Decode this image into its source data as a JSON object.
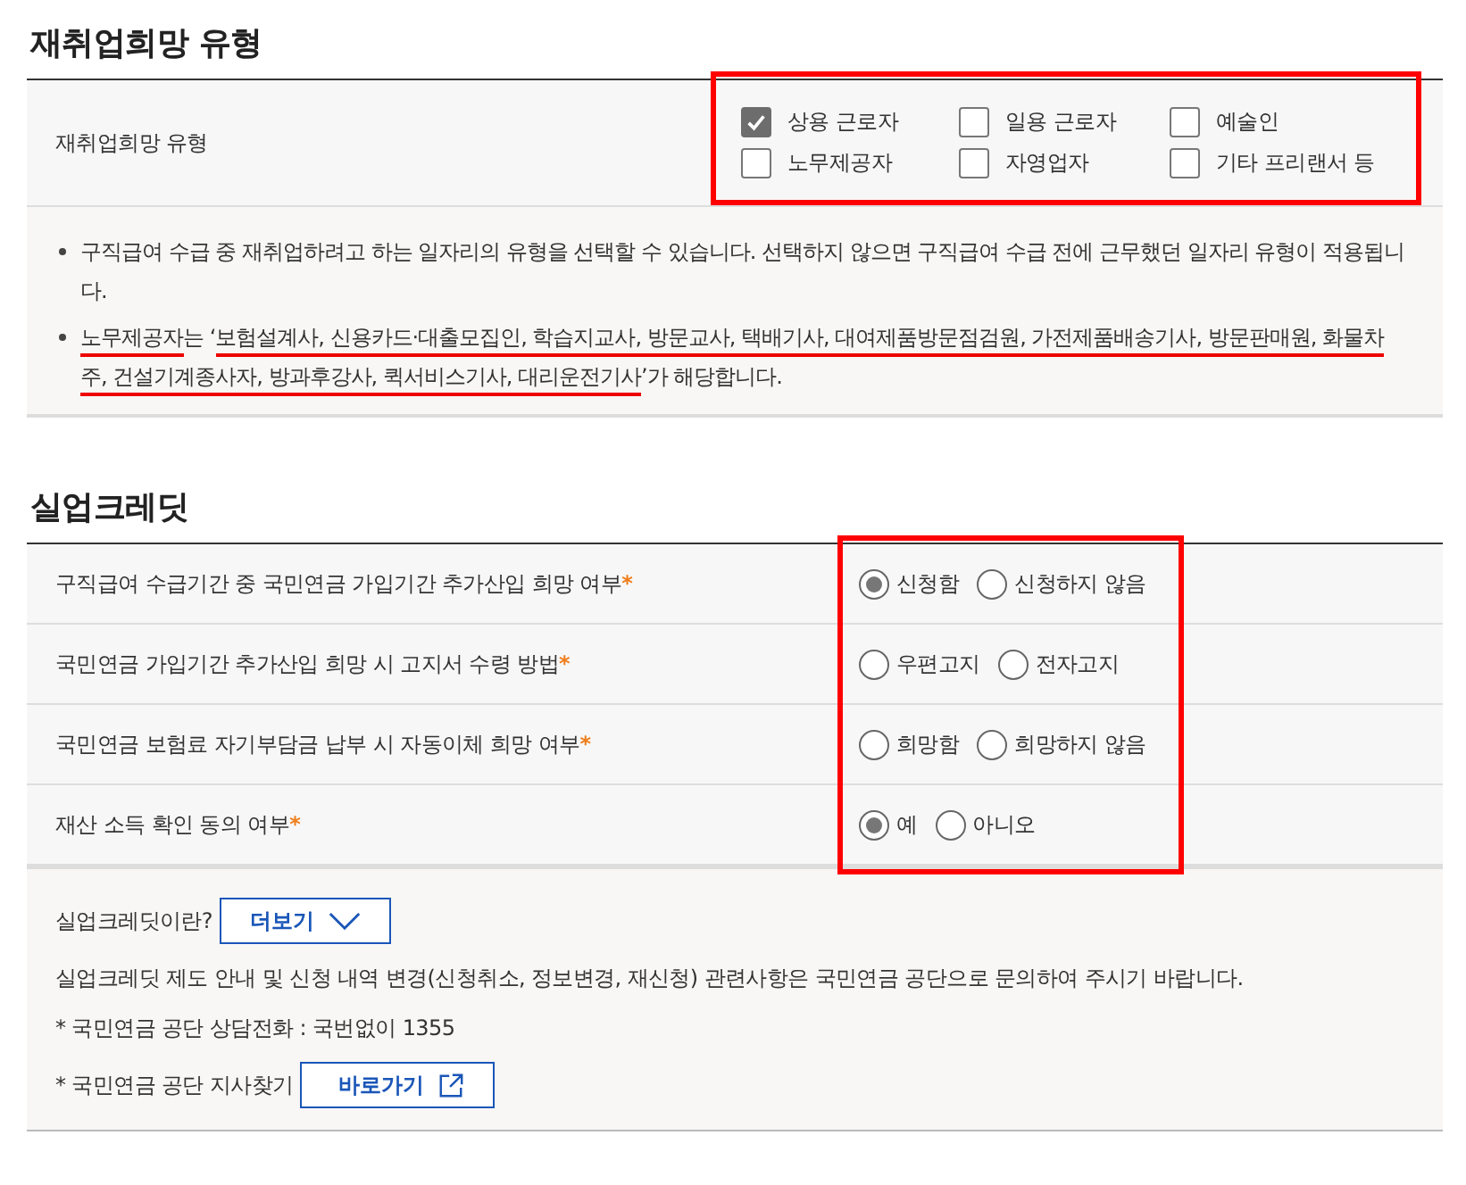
{
  "reemployment": {
    "title": "재취업희망 유형",
    "label": "재취업희망 유형",
    "highlighted": true,
    "options": [
      {
        "label": "상용 근로자",
        "checked": true
      },
      {
        "label": "일용 근로자",
        "checked": false
      },
      {
        "label": "예술인",
        "checked": false
      },
      {
        "label": "노무제공자",
        "checked": false
      },
      {
        "label": "자영업자",
        "checked": false
      },
      {
        "label": "기타 프리랜서 등",
        "checked": false
      }
    ],
    "notes": [
      [
        {
          "text": "구직급여 수급 중 재취업하려고 하는 일자리의 유형을 선택할 수 있습니다. 선택하지 않으면 구직급여 수급 전에 근무했던 일자리 유형이 적용됩니다.",
          "underlined": false
        }
      ],
      [
        {
          "text": "노무제공자",
          "underlined": true
        },
        {
          "text": "는 ‘",
          "underlined": false
        },
        {
          "text": "보험설계사, 신용카드·대출모집인, 학습지교사, 방문교사, 택배기사, 대여제품방문점검원, 가전제품배송기사, 방문판매원, 화물차주, 건설기계종사자, 방과후강사, 퀵서비스기사, 대리운전기사",
          "underlined": true
        },
        {
          "text": "’가 해당합니다.",
          "underlined": false
        }
      ]
    ]
  },
  "credit": {
    "title": "실업크레딧",
    "highlighted": true,
    "questions": [
      {
        "label": "구직급여 수급기간 중 국민연금 가입기간 추가산입 희망 여부",
        "required": true,
        "options": [
          {
            "label": "신청함",
            "selected": true
          },
          {
            "label": "신청하지 않음",
            "selected": false
          }
        ]
      },
      {
        "label": "국민연금 가입기간 추가산입 희망 시 고지서 수령 방법",
        "required": true,
        "options": [
          {
            "label": "우편고지",
            "selected": false
          },
          {
            "label": "전자고지",
            "selected": false
          }
        ]
      },
      {
        "label": "국민연금 보험료 자기부담금 납부 시 자동이체 희망 여부",
        "required": true,
        "options": [
          {
            "label": "희망함",
            "selected": false
          },
          {
            "label": "희망하지 않음",
            "selected": false
          }
        ]
      },
      {
        "label": "재산 소득 확인 동의 여부",
        "required": true,
        "options": [
          {
            "label": "예",
            "selected": true
          },
          {
            "label": "아니오",
            "selected": false
          }
        ]
      }
    ],
    "required_mark": "*",
    "info": {
      "question": "실업크레딧이란?",
      "more_button": "더보기",
      "notice": "실업크레딧 제도 안내 및 신청 내역 변경(신청취소, 정보변경, 재신청) 관련사항은 국민연금 공단으로 문의하여 주시기 바랍니다.",
      "phone": "* 국민연금 공단 상담전화 : 국번없이 1355",
      "branch": "* 국민연금 공단 지사찾기",
      "go_button": "바로가기"
    }
  }
}
